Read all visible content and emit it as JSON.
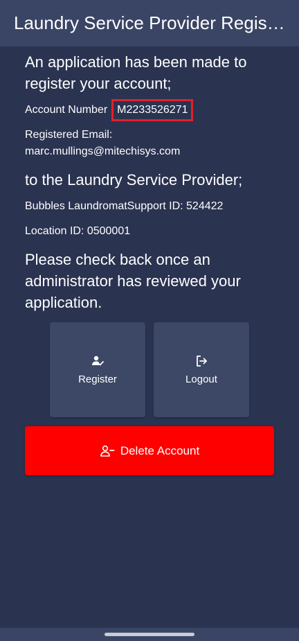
{
  "app_bar": {
    "title": "Laundry Service Provider Registration"
  },
  "main": {
    "heading_application": "An application has been made to register your account;",
    "account_number_label": "Account Number",
    "account_number_value": "M2233526271",
    "registered_email_label": "Registered Email:",
    "registered_email_value": "marc.mullings@mitechisys.com",
    "heading_provider": "to the Laundry Service Provider;",
    "provider_line": "Bubbles LaundromatSupport ID: 524422",
    "location_line": "Location ID: 0500001",
    "heading_check_back": "Please check back once an administrator has reviewed your application."
  },
  "actions": {
    "register_label": "Register",
    "register_icon": "person-check-icon",
    "logout_label": "Logout",
    "logout_icon": "logout-icon",
    "delete_label": "Delete Account",
    "delete_icon": "person-remove-icon"
  },
  "colors": {
    "background": "#2a3350",
    "app_bar": "#3a4565",
    "tile": "#3d4766",
    "delete_button": "#ff0000",
    "highlight_border": "#e3202c"
  }
}
